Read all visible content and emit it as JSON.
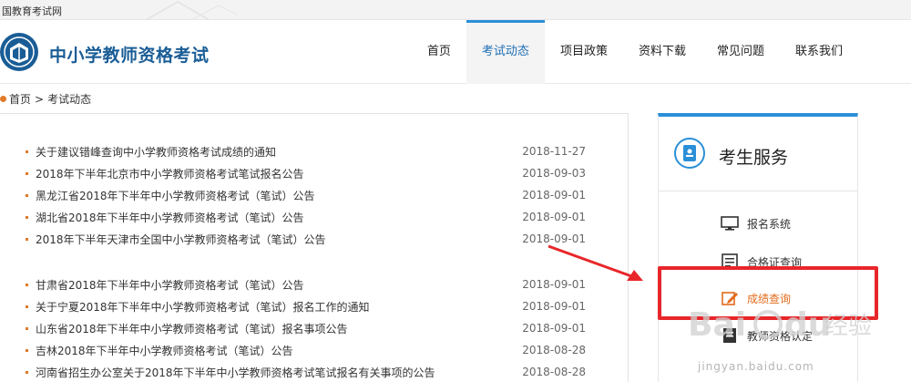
{
  "topbar": {
    "text": "国教育考试网"
  },
  "header": {
    "site_title": "中小学教师资格考试",
    "nav": [
      {
        "label": "首页",
        "active": false
      },
      {
        "label": "考试动态",
        "active": true
      },
      {
        "label": "项目政策",
        "active": false
      },
      {
        "label": "资料下载",
        "active": false
      },
      {
        "label": "常见问题",
        "active": false
      },
      {
        "label": "联系我们",
        "active": false
      }
    ]
  },
  "breadcrumb": {
    "home": "首页",
    "separator": ">",
    "current": "考试动态"
  },
  "news": {
    "group1": [
      {
        "title": "关于建议错峰查询中小学教师资格考试成绩的通知",
        "date": "2018-11-27"
      },
      {
        "title": "2018年下半年北京市中小学教师资格考试笔试报名公告",
        "date": "2018-09-03"
      },
      {
        "title": "黑龙江省2018年下半年中小学教师资格考试（笔试）公告",
        "date": "2018-09-01"
      },
      {
        "title": "湖北省2018年下半年中小学教师资格考试（笔试）公告",
        "date": "2018-09-01"
      },
      {
        "title": "2018年下半年天津市全国中小学教师资格考试（笔试）公告",
        "date": "2018-09-01"
      }
    ],
    "group2": [
      {
        "title": "甘肃省2018年下半年中小学教师资格考试（笔试）公告",
        "date": "2018-09-01"
      },
      {
        "title": "关于宁夏2018年下半年中小学教师资格考试（笔试）报名工作的通知",
        "date": "2018-09-01"
      },
      {
        "title": "山东省2018年下半年中小学教师资格考试（笔试）报名事项公告",
        "date": "2018-09-01"
      },
      {
        "title": "吉林2018年下半年中小学教师资格考试（笔试）公告",
        "date": "2018-08-28"
      },
      {
        "title": "河南省招生办公室关于2018年下半年中小学教师资格考试笔试报名有关事项的公告",
        "date": "2018-08-28"
      }
    ]
  },
  "sidebar": {
    "title": "考生服务",
    "items": [
      {
        "label": "报名系统",
        "icon": "monitor-icon"
      },
      {
        "label": "合格证查询",
        "icon": "certificate-icon"
      },
      {
        "label": "成绩查询",
        "icon": "edit-icon"
      },
      {
        "label": "教师资格认定",
        "icon": "document-icon"
      }
    ]
  },
  "watermark": {
    "text": "jingyan.baidu.com"
  },
  "colors": {
    "accent": "#2b8fd8",
    "brand": "#1a5d96",
    "bullet": "#e07b2a",
    "highlight": "#e8262a"
  }
}
